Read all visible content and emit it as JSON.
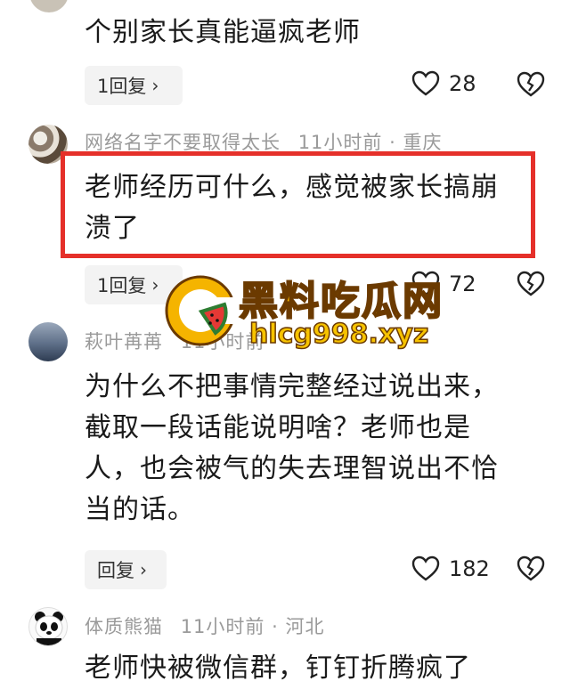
{
  "comments": [
    {
      "text": "个别家长真能逼疯老师",
      "reply_label": "1回复",
      "likes": "28"
    },
    {
      "username": "网络名字不要取得太长",
      "time": "11小时前",
      "location": "重庆",
      "text_line1": "老师经历可什么，感觉被家长搞崩",
      "text_line2": "溃了",
      "reply_label": "1回复",
      "likes": "72",
      "highlight_color": "#e5302a"
    },
    {
      "username": "萩叶苒苒",
      "time": "11小时前",
      "text_line1": "为什么不把事情完整经过说出来，",
      "text_line2": "截取一段话能说明啥？老师也是",
      "text_line3": "人，也会被气的失去理智说出不恰",
      "text_line4": "当的话。",
      "reply_label": "回复",
      "likes": "182"
    },
    {
      "username": "体质熊猫",
      "time": "11小时前",
      "location": "河北",
      "text": "老师快被微信群，钉钉折腾疯了"
    }
  ],
  "separator": "·",
  "watermark": {
    "title": "黑料吃瓜网",
    "url": "hlcg998.xyz"
  },
  "icons": {
    "like": "heart-outline-icon",
    "dislike": "broken-heart-icon",
    "chevron": "chevron-right-icon"
  }
}
